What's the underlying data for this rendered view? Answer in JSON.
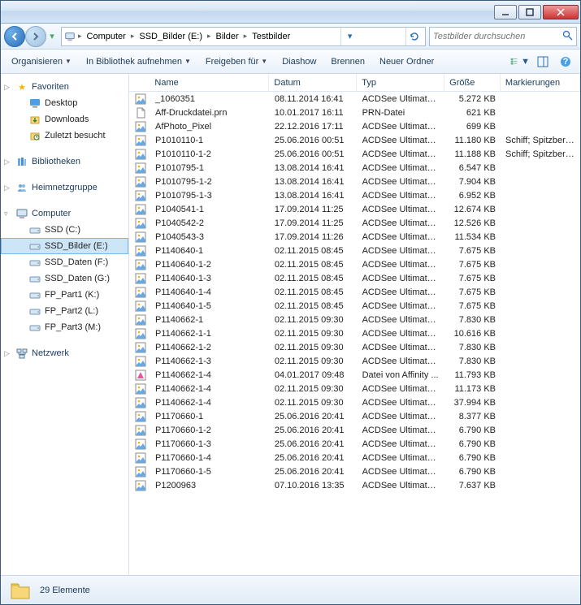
{
  "breadcrumb": [
    "Computer",
    "SSD_Bilder (E:)",
    "Bilder",
    "Testbilder"
  ],
  "search_placeholder": "Testbilder durchsuchen",
  "toolbar": {
    "organize": "Organisieren",
    "include": "In Bibliothek aufnehmen",
    "share": "Freigeben für",
    "slideshow": "Diashow",
    "burn": "Brennen",
    "newfolder": "Neuer Ordner"
  },
  "nav": {
    "favorites": {
      "label": "Favoriten",
      "items": [
        {
          "label": "Desktop",
          "icon": "desktop"
        },
        {
          "label": "Downloads",
          "icon": "folder-dl"
        },
        {
          "label": "Zuletzt besucht",
          "icon": "recent"
        }
      ]
    },
    "libraries": {
      "label": "Bibliotheken"
    },
    "homegroup": {
      "label": "Heimnetzgruppe"
    },
    "computer": {
      "label": "Computer",
      "items": [
        {
          "label": "SSD (C:)",
          "icon": "drive"
        },
        {
          "label": "SSD_Bilder (E:)",
          "icon": "drive",
          "selected": true
        },
        {
          "label": "SSD_Daten (F:)",
          "icon": "drive"
        },
        {
          "label": "SSD_Daten (G:)",
          "icon": "drive"
        },
        {
          "label": "FP_Part1 (K:)",
          "icon": "drive"
        },
        {
          "label": "FP_Part2 (L:)",
          "icon": "drive"
        },
        {
          "label": "FP_Part3 (M:)",
          "icon": "drive"
        }
      ]
    },
    "network": {
      "label": "Netzwerk"
    }
  },
  "columns": {
    "name": "Name",
    "date": "Datum",
    "type": "Typ",
    "size": "Größe",
    "tags": "Markierungen"
  },
  "files": [
    {
      "name": "_1060351",
      "date": "08.11.2014 16:41",
      "type": "ACDSee Ultimate ...",
      "size": "5.272 KB",
      "tags": "",
      "icon": "img"
    },
    {
      "name": "Aff-Druckdatei.prn",
      "date": "10.01.2017 16:11",
      "type": "PRN-Datei",
      "size": "621 KB",
      "tags": "",
      "icon": "file"
    },
    {
      "name": "AfPhoto_Pixel",
      "date": "22.12.2016 17:11",
      "type": "ACDSee Ultimate ...",
      "size": "699 KB",
      "tags": "",
      "icon": "img"
    },
    {
      "name": "P1010110-1",
      "date": "25.06.2016 00:51",
      "type": "ACDSee Ultimate ...",
      "size": "11.180 KB",
      "tags": "Schiff; Spitzbergen",
      "icon": "img"
    },
    {
      "name": "P1010110-1-2",
      "date": "25.06.2016 00:51",
      "type": "ACDSee Ultimate ...",
      "size": "11.188 KB",
      "tags": "Schiff; Spitzbergen",
      "icon": "img"
    },
    {
      "name": "P1010795-1",
      "date": "13.08.2014 16:41",
      "type": "ACDSee Ultimate ...",
      "size": "6.547 KB",
      "tags": "",
      "icon": "img"
    },
    {
      "name": "P1010795-1-2",
      "date": "13.08.2014 16:41",
      "type": "ACDSee Ultimate ...",
      "size": "7.904 KB",
      "tags": "",
      "icon": "img"
    },
    {
      "name": "P1010795-1-3",
      "date": "13.08.2014 16:41",
      "type": "ACDSee Ultimate ...",
      "size": "6.952 KB",
      "tags": "",
      "icon": "img"
    },
    {
      "name": "P1040541-1",
      "date": "17.09.2014 11:25",
      "type": "ACDSee Ultimate ...",
      "size": "12.674 KB",
      "tags": "",
      "icon": "img"
    },
    {
      "name": "P1040542-2",
      "date": "17.09.2014 11:25",
      "type": "ACDSee Ultimate ...",
      "size": "12.526 KB",
      "tags": "",
      "icon": "img"
    },
    {
      "name": "P1040543-3",
      "date": "17.09.2014 11:26",
      "type": "ACDSee Ultimate ...",
      "size": "11.534 KB",
      "tags": "",
      "icon": "img"
    },
    {
      "name": "P1140640-1",
      "date": "02.11.2015 08:45",
      "type": "ACDSee Ultimate ...",
      "size": "7.675 KB",
      "tags": "",
      "icon": "img"
    },
    {
      "name": "P1140640-1-2",
      "date": "02.11.2015 08:45",
      "type": "ACDSee Ultimate ...",
      "size": "7.675 KB",
      "tags": "",
      "icon": "img"
    },
    {
      "name": "P1140640-1-3",
      "date": "02.11.2015 08:45",
      "type": "ACDSee Ultimate ...",
      "size": "7.675 KB",
      "tags": "",
      "icon": "img"
    },
    {
      "name": "P1140640-1-4",
      "date": "02.11.2015 08:45",
      "type": "ACDSee Ultimate ...",
      "size": "7.675 KB",
      "tags": "",
      "icon": "img"
    },
    {
      "name": "P1140640-1-5",
      "date": "02.11.2015 08:45",
      "type": "ACDSee Ultimate ...",
      "size": "7.675 KB",
      "tags": "",
      "icon": "img"
    },
    {
      "name": "P1140662-1",
      "date": "02.11.2015 09:30",
      "type": "ACDSee Ultimate ...",
      "size": "7.830 KB",
      "tags": "",
      "icon": "img"
    },
    {
      "name": "P1140662-1-1",
      "date": "02.11.2015 09:30",
      "type": "ACDSee Ultimate ...",
      "size": "10.616 KB",
      "tags": "",
      "icon": "img"
    },
    {
      "name": "P1140662-1-2",
      "date": "02.11.2015 09:30",
      "type": "ACDSee Ultimate ...",
      "size": "7.830 KB",
      "tags": "",
      "icon": "img"
    },
    {
      "name": "P1140662-1-3",
      "date": "02.11.2015 09:30",
      "type": "ACDSee Ultimate ...",
      "size": "7.830 KB",
      "tags": "",
      "icon": "img"
    },
    {
      "name": "P1140662-1-4",
      "date": "04.01.2017 09:48",
      "type": "Datei von Affinity ...",
      "size": "11.793 KB",
      "tags": "",
      "icon": "aff"
    },
    {
      "name": "P1140662-1-4",
      "date": "02.11.2015 09:30",
      "type": "ACDSee Ultimate ...",
      "size": "11.173 KB",
      "tags": "",
      "icon": "img"
    },
    {
      "name": "P1140662-1-4",
      "date": "02.11.2015 09:30",
      "type": "ACDSee Ultimate ...",
      "size": "37.994 KB",
      "tags": "",
      "icon": "img"
    },
    {
      "name": "P1170660-1",
      "date": "25.06.2016 20:41",
      "type": "ACDSee Ultimate ...",
      "size": "8.377 KB",
      "tags": "",
      "icon": "img"
    },
    {
      "name": "P1170660-1-2",
      "date": "25.06.2016 20:41",
      "type": "ACDSee Ultimate ...",
      "size": "6.790 KB",
      "tags": "",
      "icon": "img"
    },
    {
      "name": "P1170660-1-3",
      "date": "25.06.2016 20:41",
      "type": "ACDSee Ultimate ...",
      "size": "6.790 KB",
      "tags": "",
      "icon": "img"
    },
    {
      "name": "P1170660-1-4",
      "date": "25.06.2016 20:41",
      "type": "ACDSee Ultimate ...",
      "size": "6.790 KB",
      "tags": "",
      "icon": "img"
    },
    {
      "name": "P1170660-1-5",
      "date": "25.06.2016 20:41",
      "type": "ACDSee Ultimate ...",
      "size": "6.790 KB",
      "tags": "",
      "icon": "img"
    },
    {
      "name": "P1200963",
      "date": "07.10.2016 13:35",
      "type": "ACDSee Ultimate ...",
      "size": "7.637 KB",
      "tags": "",
      "icon": "img"
    }
  ],
  "status": {
    "count": "29 Elemente"
  }
}
